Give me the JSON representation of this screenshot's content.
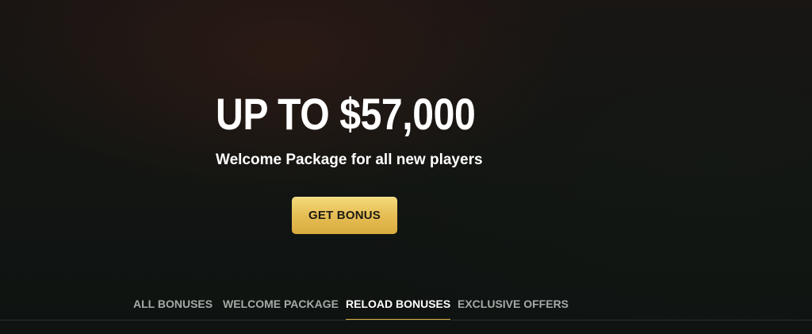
{
  "hero": {
    "headline": "UP TO $57,000",
    "subtitle": "Welcome Package for all new players",
    "cta_label": "GET BONUS"
  },
  "tabs": [
    {
      "label": "ALL BONUSES",
      "active": false
    },
    {
      "label": "WELCOME PACKAGE",
      "active": false
    },
    {
      "label": "RELOAD BONUSES",
      "active": true
    },
    {
      "label": "EXCLUSIVE OFFERS",
      "active": false
    }
  ],
  "colors": {
    "accent": "#d8ae45",
    "button_gradient_top": "#f4da7c",
    "button_gradient_bottom": "#d9ab3f",
    "background": "#121512",
    "tab_inactive_text": "#a7aaa6",
    "text_primary": "#ffffff"
  }
}
